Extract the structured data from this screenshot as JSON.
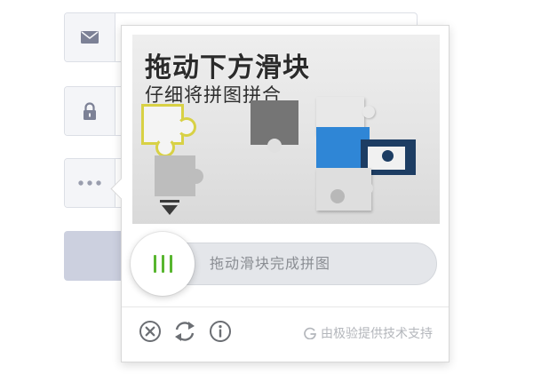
{
  "background_form": {
    "fields": [
      {
        "icon": "envelope-icon"
      },
      {
        "icon": "lock-icon"
      },
      {
        "icon": "more-dots-icon"
      }
    ]
  },
  "captcha": {
    "puzzle_title": "拖动下方滑块",
    "puzzle_subtitle": "仔细将拼图拼合",
    "slider_hint": "拖动滑块完成拼图",
    "footer": {
      "close_icon": "close-circle-icon",
      "refresh_icon": "refresh-icon",
      "info_icon": "info-icon",
      "powered_by": "由极验提供技术支持",
      "brand_icon": "geetest-logo-icon"
    },
    "colors": {
      "accent_green": "#58b62f",
      "piece_yellow": "#d8d145",
      "piece_blue": "#2f86d6"
    }
  }
}
